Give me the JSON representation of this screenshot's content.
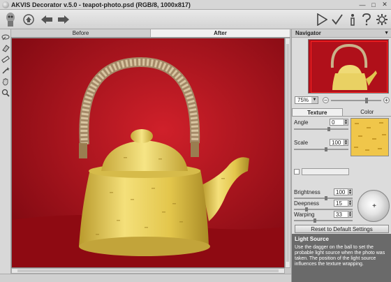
{
  "window": {
    "title": "AKVIS Decorator v.5.0 - teapot-photo.psd (RGB/8, 1000x817)",
    "controls": [
      "minimize-icon",
      "maximize-icon",
      "close-icon"
    ]
  },
  "toolbar": {
    "left_icons": [
      "logo-icon",
      "open-icon",
      "undo-icon",
      "redo-icon"
    ],
    "right_icons": [
      "run-icon",
      "apply-icon",
      "info-icon",
      "help-icon",
      "settings-icon"
    ]
  },
  "tools": [
    "selection-brush-icon",
    "eraser-icon",
    "ruler-icon",
    "magic-wand-icon",
    "hand-icon",
    "zoom-icon"
  ],
  "view_tabs": {
    "before": "Before",
    "after": "After",
    "active": "After"
  },
  "navigator": {
    "title": "Navigator",
    "zoom": "75%",
    "zoom_slider": 0.72
  },
  "settings": {
    "tabs": [
      "Texture",
      "Color"
    ],
    "active_tab": "Texture",
    "angle_label": "Angle",
    "angle_value": "0",
    "scale_label": "Scale",
    "scale_value": "100",
    "brightness_label": "Brightness",
    "brightness_value": "100",
    "deepness_label": "Deepness",
    "deepness_value": "15",
    "warping_label": "Warping",
    "warping_value": "33",
    "reset_button": "Reset to Default Settings"
  },
  "help": {
    "title": "Light Source",
    "text": "Use the dagger on the ball to set the probable light source when the photo was taken. The position of the light source influences the texture wrapping."
  },
  "colors": {
    "background_red": "#b0101a",
    "teapot_yellow": "#e8cd54",
    "panel_grey": "#dcdcdc",
    "help_bg": "#6a6a6a"
  }
}
